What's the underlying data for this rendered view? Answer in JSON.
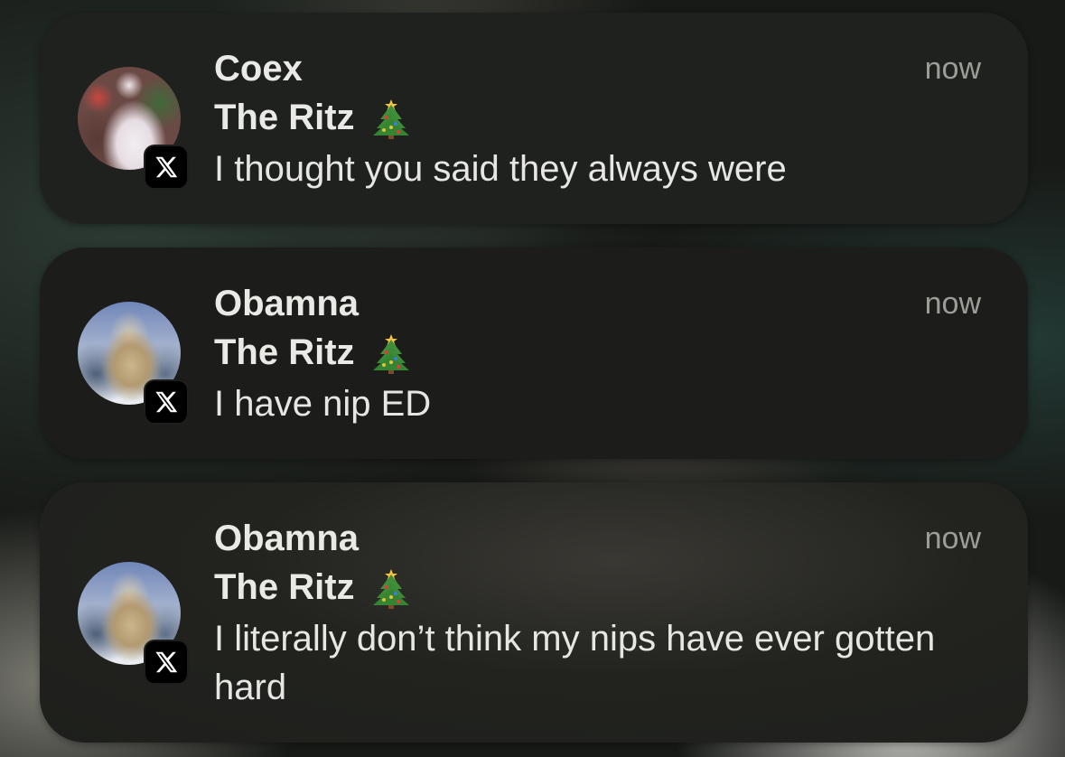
{
  "notifications": [
    {
      "sender": "Coex",
      "subtitle": "The Ritz",
      "subtitle_emoji": "christmas-tree-icon",
      "message": "I thought you said they always were",
      "time": "now",
      "app": "X"
    },
    {
      "sender": "Obamna",
      "subtitle": "The Ritz",
      "subtitle_emoji": "christmas-tree-icon",
      "message": "I have nip ED",
      "time": "now",
      "app": "X"
    },
    {
      "sender": "Obamna",
      "subtitle": "The Ritz",
      "subtitle_emoji": "christmas-tree-icon",
      "message": "I literally don’t think my nips have ever gotten hard",
      "time": "now",
      "app": "X"
    }
  ],
  "colors": {
    "card_background": "#1e1f1c",
    "primary_text": "#e9e9e6",
    "secondary_text": "#9d9d98",
    "badge_background": "#000000"
  }
}
